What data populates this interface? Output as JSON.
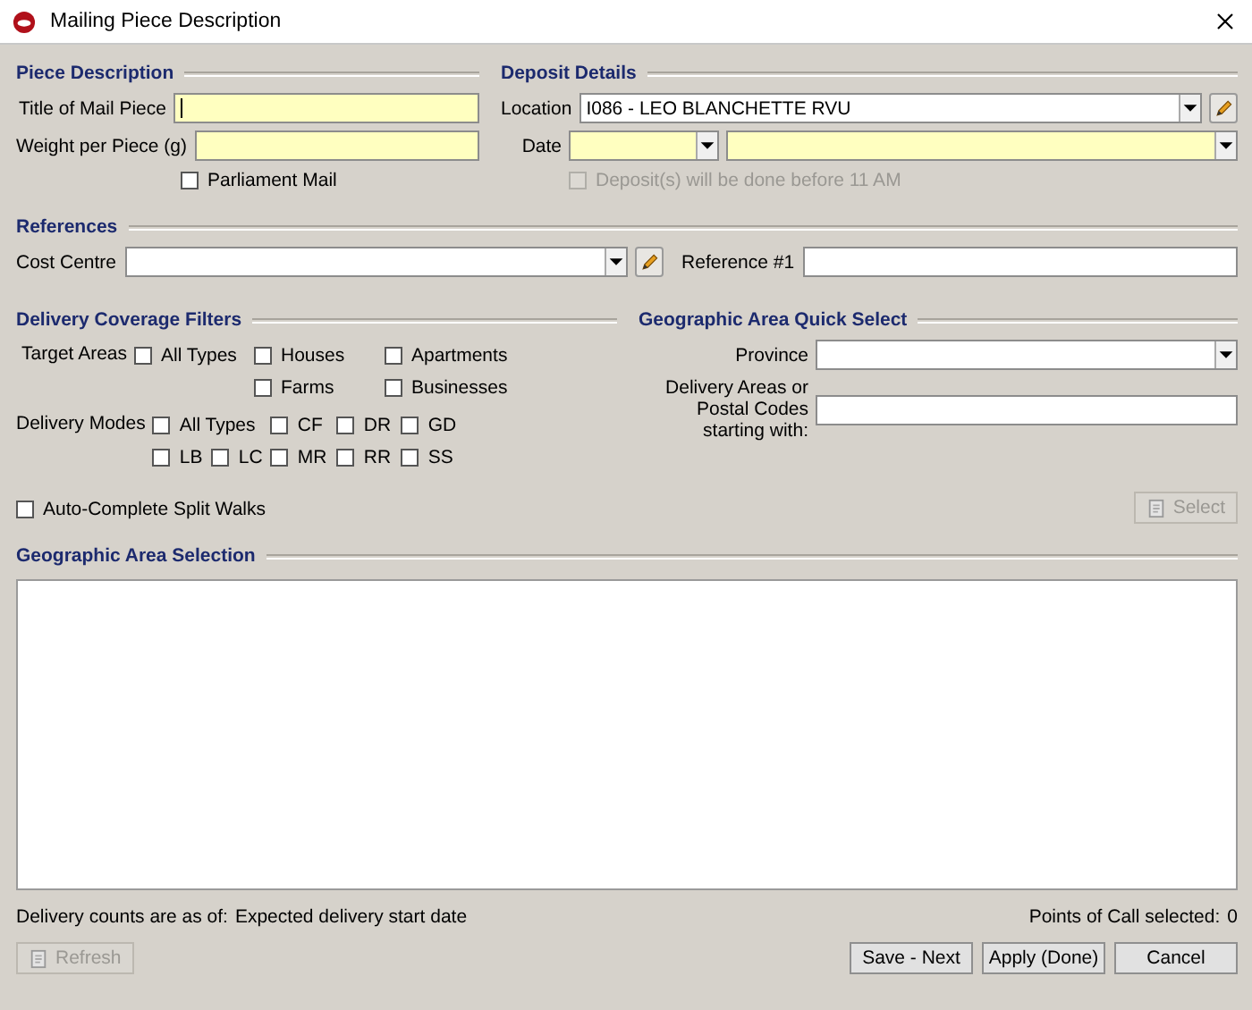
{
  "window": {
    "title": "Mailing Piece Description"
  },
  "piece_description": {
    "heading": "Piece Description",
    "fields": [
      {
        "label": "Title of Mail Piece",
        "focused": true
      },
      {
        "label": "Weight per Piece (g)",
        "focused": false
      }
    ],
    "parliament_mail": {
      "label": "Parliament Mail",
      "checked": false
    }
  },
  "deposit_details": {
    "heading": "Deposit Details",
    "location": {
      "label": "Location",
      "value": "I086 - LEO BLANCHETTE RVU"
    },
    "date": {
      "label": "Date"
    },
    "before_11am": {
      "label": "Deposit(s) will be done before 11 AM",
      "checked": false,
      "disabled": true
    }
  },
  "references": {
    "heading": "References",
    "cost_centre": {
      "label": "Cost Centre"
    },
    "reference_1": {
      "label": "Reference #1"
    }
  },
  "delivery_coverage_filters": {
    "heading": "Delivery Coverage Filters",
    "target_areas": {
      "label": "Target Areas",
      "rows": [
        [
          {
            "label": "All Types",
            "checked": false
          },
          {
            "label": "Houses",
            "checked": false
          },
          {
            "label": "Apartments",
            "checked": false
          }
        ],
        [
          {},
          {
            "label": "Farms",
            "checked": false
          },
          {
            "label": "Businesses",
            "checked": false
          }
        ]
      ]
    },
    "delivery_modes": {
      "label": "Delivery Modes",
      "rows": [
        [
          {
            "label": "All Types",
            "checked": false
          },
          {},
          {
            "label": "CF",
            "checked": false
          },
          {
            "label": "DR",
            "checked": false
          },
          {
            "label": "GD",
            "checked": false
          }
        ],
        [
          {
            "label": "LB",
            "checked": false
          },
          {
            "label": "LC",
            "checked": false
          },
          {
            "label": "MR",
            "checked": false
          },
          {
            "label": "RR",
            "checked": false
          },
          {
            "label": "SS",
            "checked": false
          }
        ]
      ]
    },
    "auto_complete": {
      "label": "Auto-Complete Split Walks",
      "checked": false
    }
  },
  "geographic_quick_select": {
    "heading": "Geographic Area Quick Select",
    "province": {
      "label": "Province"
    },
    "delivery_areas": {
      "label": "Delivery Areas or Postal Codes starting with:"
    },
    "select_button": {
      "label": "Select",
      "disabled": true
    }
  },
  "geographic_area_selection": {
    "heading": "Geographic Area Selection"
  },
  "footer": {
    "counts_label": "Delivery counts are as of:",
    "counts_value": "Expected delivery start date",
    "points_label": "Points of Call selected:",
    "points_value": "0"
  },
  "refresh_button": {
    "label": "Refresh",
    "disabled": true
  },
  "buttons": [
    {
      "label": "Save - Next",
      "disabled": false
    },
    {
      "label": "Apply (Done)",
      "disabled": false
    },
    {
      "label": "Cancel",
      "disabled": false
    }
  ]
}
